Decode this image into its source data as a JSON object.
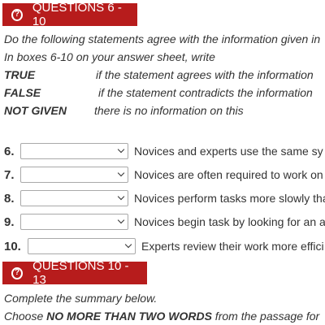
{
  "section1": {
    "header": "QUESTIONS 6 - 10",
    "instruction1": "Do the following statements agree with the information given in",
    "instruction2": "In boxes 6-10 on your answer sheet, write",
    "terms": [
      {
        "term": "TRUE",
        "desc": "if the statement agrees with the information"
      },
      {
        "term": "FALSE",
        "desc": "if the statement contradicts the information"
      },
      {
        "term": "NOT GIVEN",
        "desc": "there is no information on this"
      }
    ],
    "questions": [
      {
        "num": "6.",
        "text": "Novices and experts use the same sy",
        "selected": ""
      },
      {
        "num": "7.",
        "text": "Novices are often required to work on",
        "selected": ""
      },
      {
        "num": "8.",
        "text": "Novices perform tasks more slowly tha",
        "selected": ""
      },
      {
        "num": "9.",
        "text": "Novices begin task by looking for an a",
        "selected": ""
      },
      {
        "num": "10.",
        "text": "Experts review their work more effici",
        "selected": ""
      }
    ]
  },
  "section2": {
    "header": "QUESTIONS 10 - 13",
    "instruction1": "Complete the summary below.",
    "instruction2_prefix": "Choose ",
    "instruction2_bold": "NO MORE THAN TWO WORDS",
    "instruction2_suffix": " from the passage for"
  },
  "colors": {
    "header_bg": "#b71c1c",
    "header_text": "#ffffff",
    "body_text": "#333333"
  },
  "icons": {
    "header_icon": "help-circle-icon",
    "select_icon": "chevron-down-icon"
  }
}
